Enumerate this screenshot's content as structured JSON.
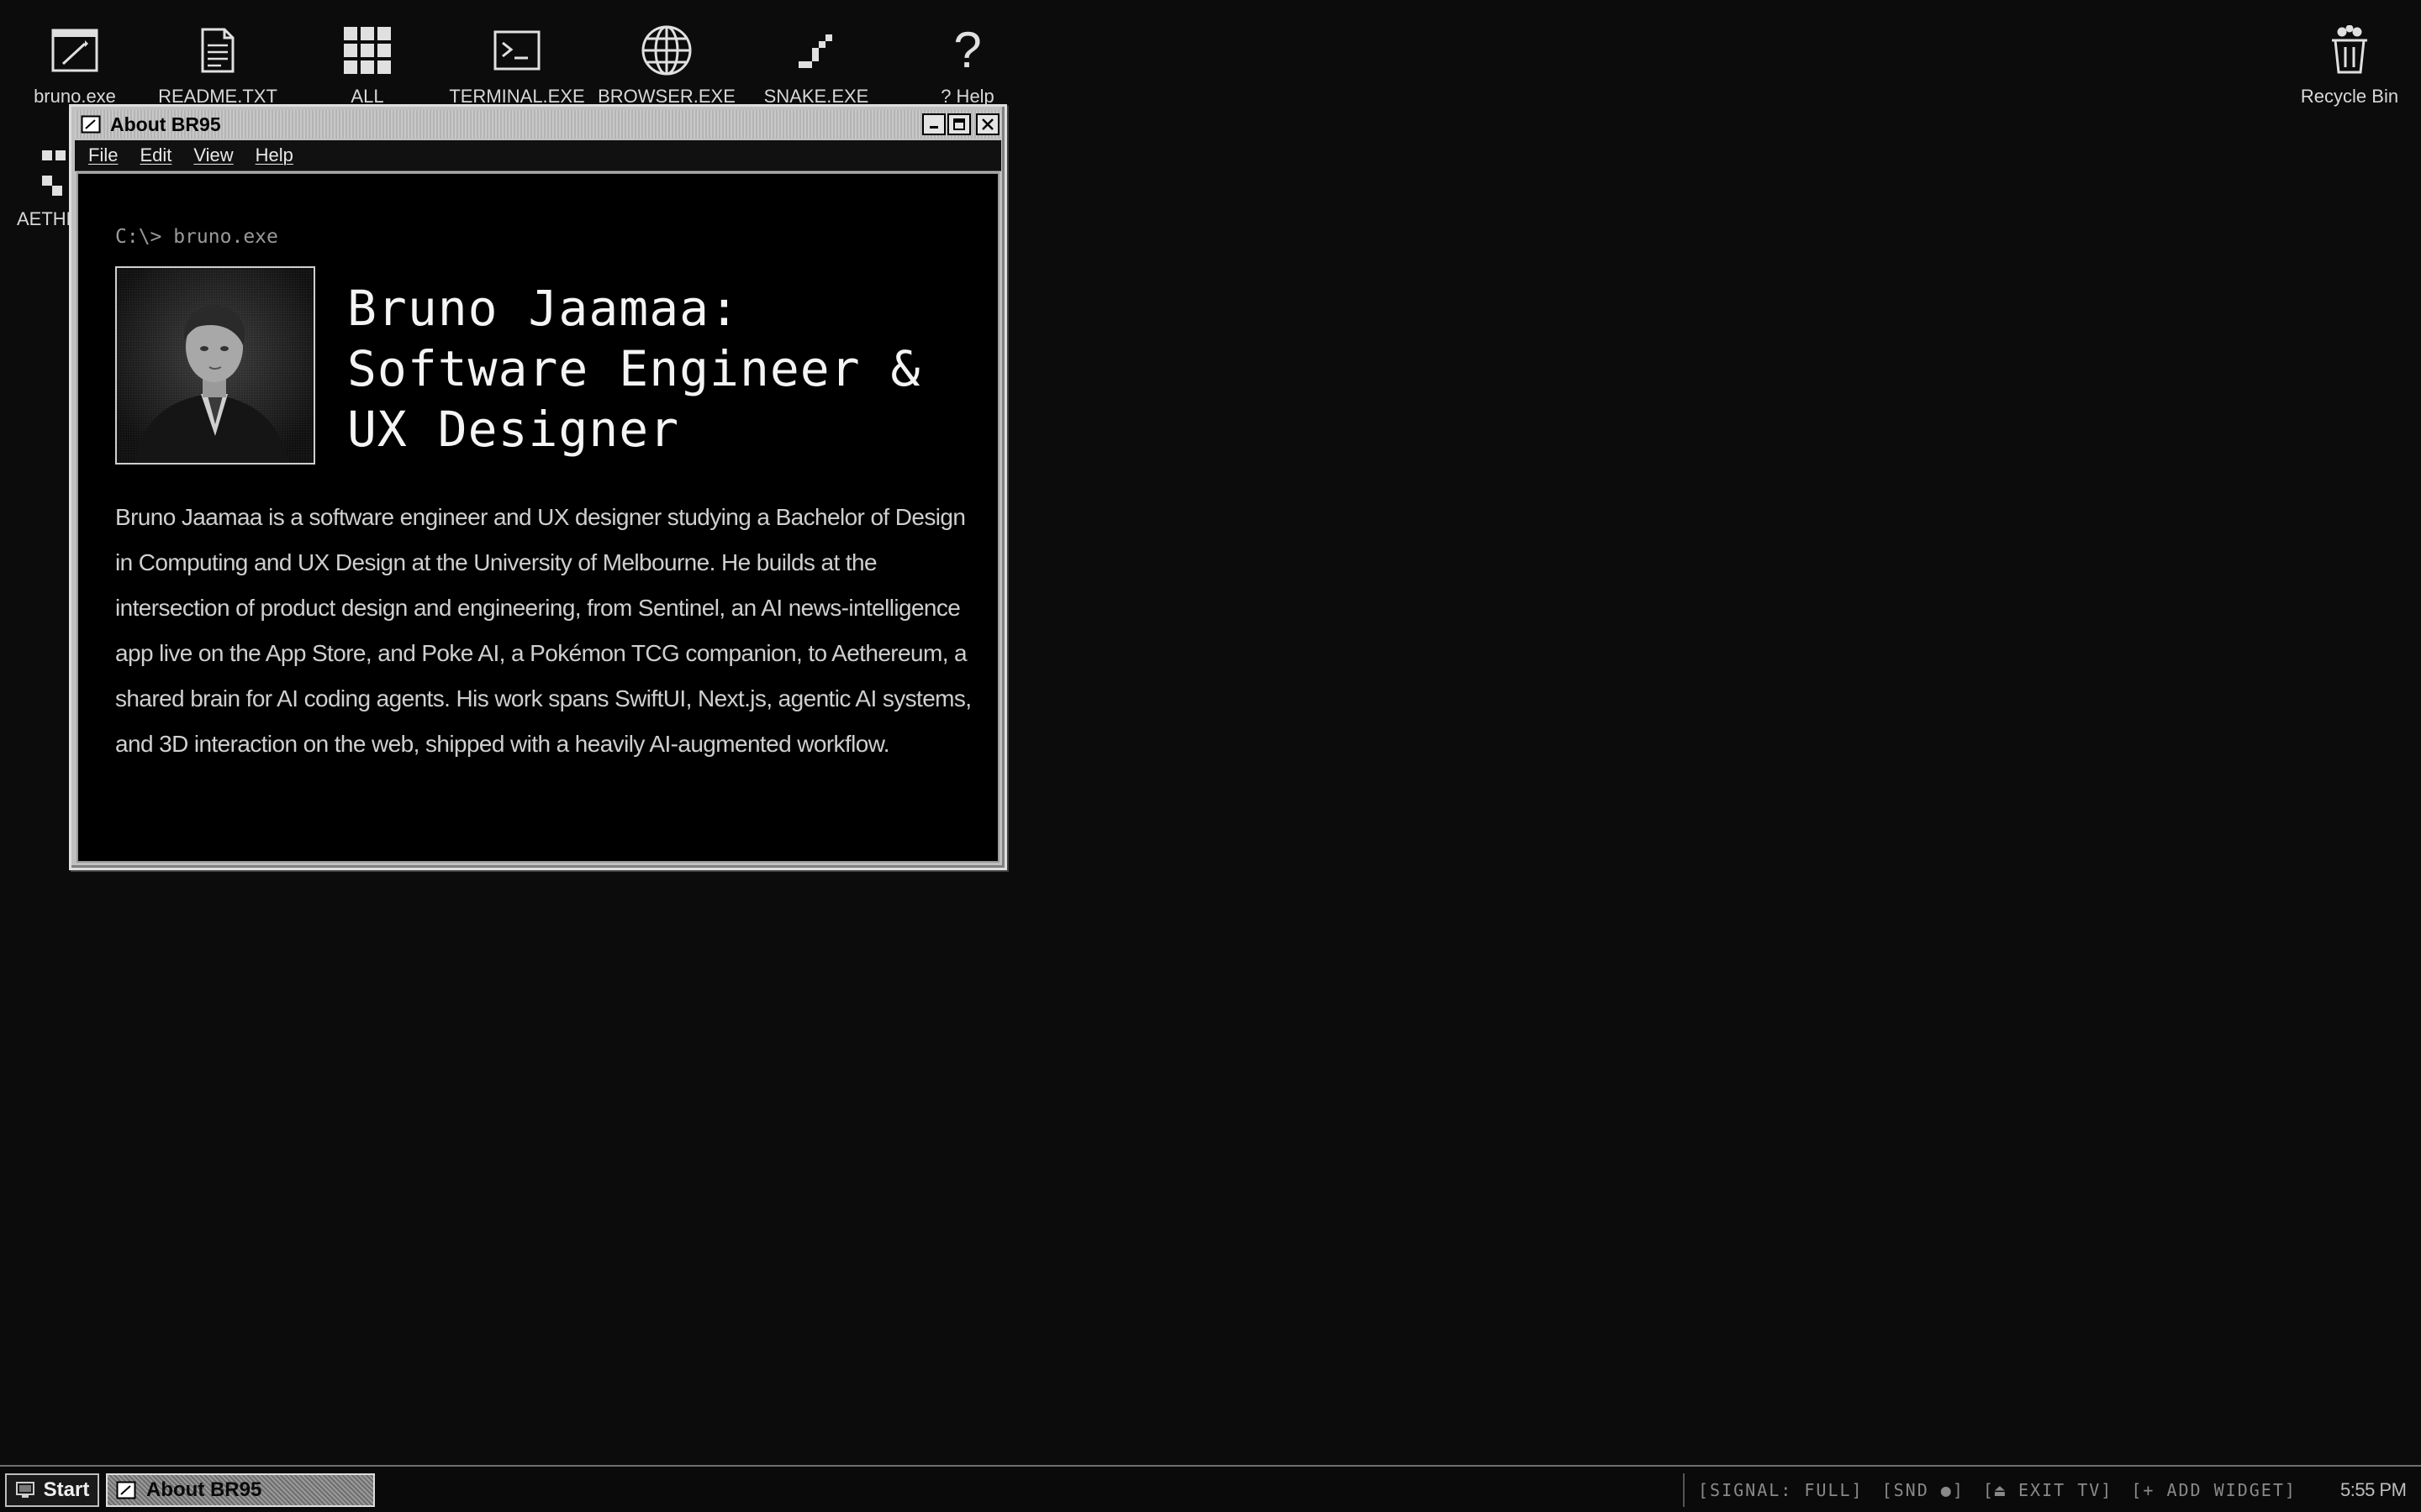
{
  "desktop": {
    "icons": [
      {
        "label": "bruno.exe",
        "icon": "pen-window-icon"
      },
      {
        "label": "README.TXT",
        "icon": "document-icon"
      },
      {
        "label": "ALL",
        "icon": "grid-icon"
      },
      {
        "label": "TERMINAL.EXE",
        "icon": "terminal-icon"
      },
      {
        "label": "BROWSER.EXE",
        "icon": "globe-icon"
      },
      {
        "label": "SNAKE.EXE",
        "icon": "snake-icon"
      },
      {
        "label": "? Help",
        "icon": "question-icon"
      },
      {
        "label": "Recycle Bin",
        "icon": "recycle-bin-icon"
      },
      {
        "label": "AETHE",
        "icon": "pixel-blocks-icon"
      }
    ]
  },
  "window": {
    "title": "About BR95",
    "menu": [
      "File",
      "Edit",
      "View",
      "Help"
    ],
    "prompt": "C:\\> bruno.exe",
    "headline": [
      "Bruno Jaamaa:",
      "Software Engineer &",
      "UX Designer"
    ],
    "bio": "Bruno Jaamaa is a software engineer and UX designer studying a Bachelor of Design in Computing and UX Design at the University of Melbourne. He builds at the intersection of product design and engineering, from Sentinel, an AI news-intelligence app live on the App Store, and Poke AI, a Pokémon TCG companion, to Aethereum, a shared brain for AI coding agents. His work spans SwiftUI, Next.js, agentic AI systems, and 3D interaction on the web, shipped with a heavily AI-augmented workflow."
  },
  "taskbar": {
    "start_label": "Start",
    "task_label": "About BR95",
    "tray": [
      "[SIGNAL: FULL]",
      "[SND ●]",
      "[⏏ EXIT TV]",
      "[+ ADD WIDGET]"
    ],
    "clock": "5:55 PM"
  }
}
